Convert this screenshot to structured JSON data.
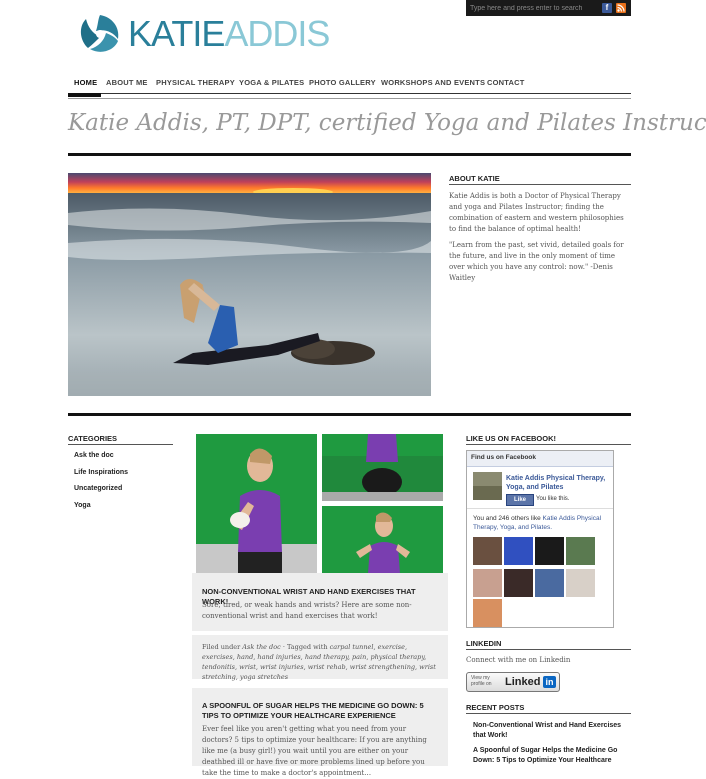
{
  "search": {
    "placeholder": "Type here and press enter to search"
  },
  "social": {
    "facebook": "f",
    "rss": "r"
  },
  "logo": {
    "part1": "KATIE",
    "part2": "ADDIS"
  },
  "nav": {
    "items": [
      "HOME",
      "ABOUT ME",
      "PHYSICAL THERAPY",
      "YOGA & PILATES",
      "PHOTO GALLERY",
      "WORKSHOPS AND EVENTS",
      "CONTACT"
    ]
  },
  "headline": "Katie Addis, PT, DPT, certified Yoga and Pilates Instructor",
  "about": {
    "title": "ABOUT KATIE",
    "p1": "Katie Addis is both a Doctor of Physical Therapy and yoga and Pilates Instructor; finding the combination of eastern and western philosophies to find the balance of optimal health!",
    "p2": "\"Learn from the past, set vivid, detailed goals for the future, and live in the only moment of time over which you have any control: now.\" -Denis Waitley"
  },
  "categories": {
    "title": "CATEGORIES",
    "items": [
      "Ask the doc",
      "Life Inspirations",
      "Uncategorized",
      "Yoga"
    ]
  },
  "posts": [
    {
      "title": "NON-CONVENTIONAL WRIST AND HAND EXERCISES THAT WORK!",
      "excerpt": "Sore, tired, or weak hands and wrists? Here are some non-conventional wrist and hand exercises that work!",
      "filed_prefix": "Filed under ",
      "category": "Ask the doc",
      "tagged_prefix": " · Tagged with ",
      "tags": "carpal tunnel, exercise, exercises, hand, hand injuries, hand therapy, pain, physical therapy, tendonitis, wrist, wrist injuries, wrist rehab, wrist strengthening, wrist stretching, yoga stretches"
    },
    {
      "title": "A SPOONFUL OF SUGAR HELPS THE MEDICINE GO DOWN: 5 TIPS TO OPTIMIZE YOUR HEALTHCARE EXPERIENCE",
      "excerpt": "Ever feel like you aren't getting what you need from your doctors? 5 tips to optimize your healthcare: If you are anything like me (a busy girl!) you wait until you are either on your deathbed ill or have five or more problems lined up before you take the time to make a doctor's appointment…"
    }
  ],
  "facebook": {
    "title": "LIKE US ON FACEBOOK!",
    "header": "Find us on Facebook",
    "page_name": "Katie Addis Physical Therapy, Yoga, and Pilates",
    "like_button": "Like",
    "you_like": "You like this.",
    "others_prefix": "You and 246 others like ",
    "others_link": "Katie Addis Physical Therapy, Yoga, and Pilates."
  },
  "linkedin": {
    "title": "LINKEDIN",
    "text": "Connect with me on Linkedin",
    "badge_small1": "View my",
    "badge_small2": "profile on",
    "badge_brand": "Linked",
    "badge_in": "in"
  },
  "recent": {
    "title": "RECENT POSTS",
    "items": [
      "Non-Conventional Wrist and Hand Exercises that Work!",
      "A Spoonful of Sugar Helps the Medicine Go Down: 5 Tips to Optimize Your Healthcare"
    ]
  }
}
